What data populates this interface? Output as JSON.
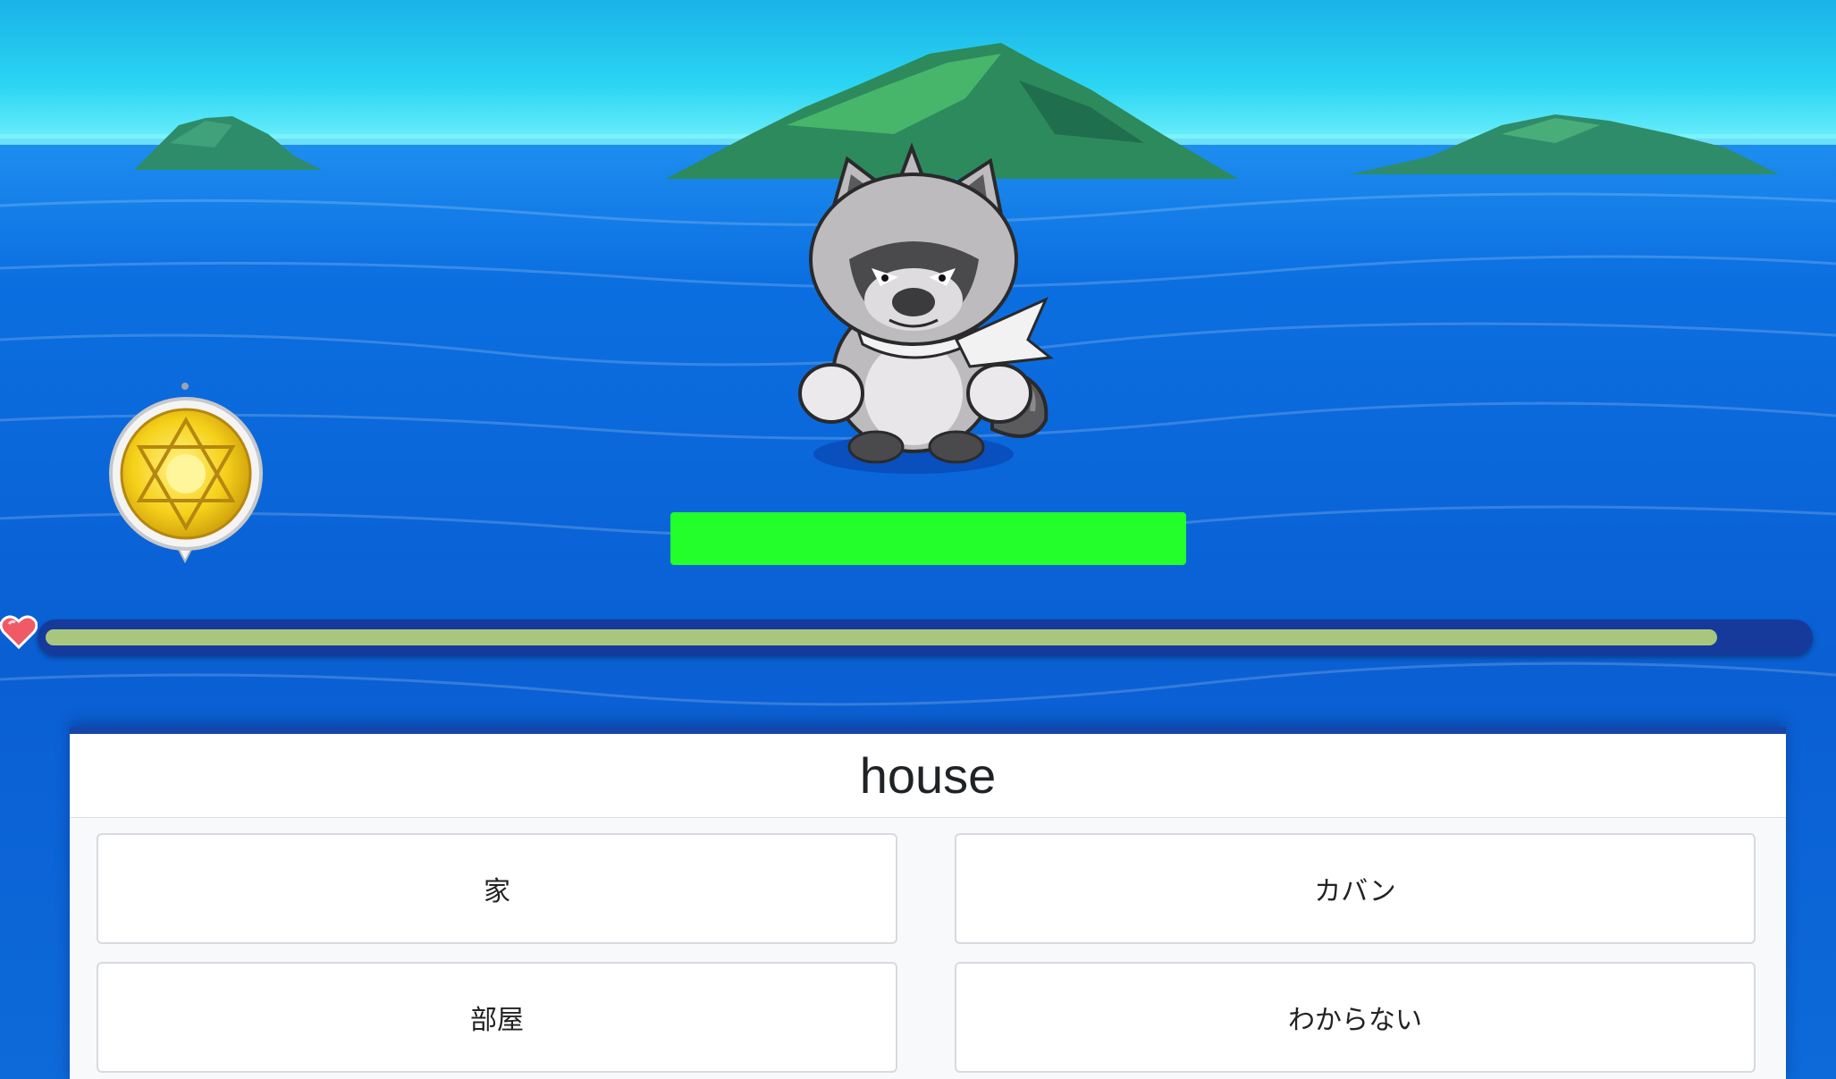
{
  "question": {
    "word": "house"
  },
  "answers": [
    {
      "label": "家"
    },
    {
      "label": "カバン"
    },
    {
      "label": "部屋"
    },
    {
      "label": "わからない"
    }
  ],
  "enemy": {
    "health_fraction": 1.0,
    "health_color": "#22ff2a"
  },
  "player": {
    "health_fraction": 0.95,
    "health_color": "#a9c77c",
    "heart_icon": "heart-icon"
  },
  "item": {
    "icon": "hexagram-medallion-icon",
    "color": "#f6d11a"
  },
  "colors": {
    "sky": "#29d3f2",
    "sea": "#0a63d6",
    "panel_border": "#1546ab"
  }
}
